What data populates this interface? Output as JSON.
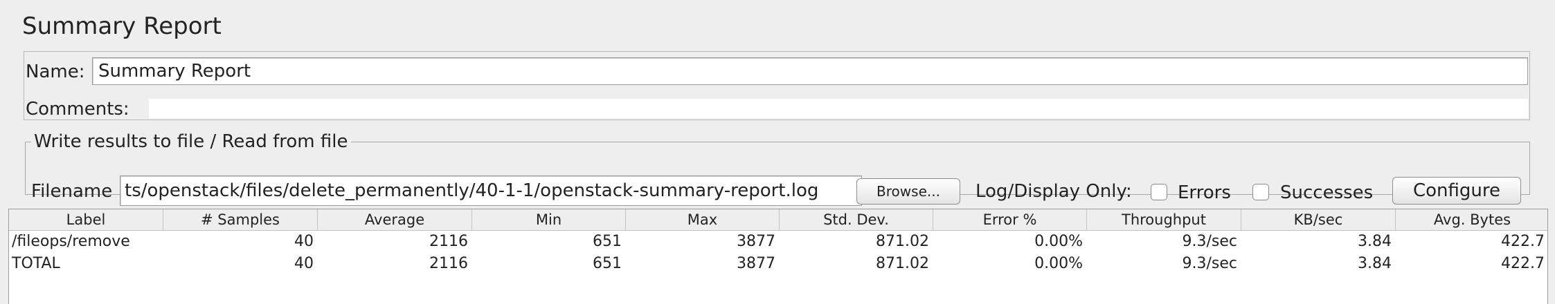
{
  "page_title": "Summary Report",
  "name_label": "Name:",
  "name_value": "Summary Report",
  "comments_label": "Comments:",
  "file_panel": {
    "legend": "Write results to file / Read from file",
    "filename_label": "Filename",
    "filename_value": "ts/openstack/files/delete_permanently/40-1-1/openstack-summary-report.log",
    "browse_label": "Browse...",
    "log_display_label": "Log/Display Only:",
    "errors_label": "Errors",
    "successes_label": "Successes",
    "configure_label": "Configure"
  },
  "table": {
    "headers": [
      "Label",
      "# Samples",
      "Average",
      "Min",
      "Max",
      "Std. Dev.",
      "Error %",
      "Throughput",
      "KB/sec",
      "Avg. Bytes"
    ],
    "rows": [
      [
        "/fileops/remove",
        "40",
        "2116",
        "651",
        "3877",
        "871.02",
        "0.00%",
        "9.3/sec",
        "3.84",
        "422.7"
      ],
      [
        "TOTAL",
        "40",
        "2116",
        "651",
        "3877",
        "871.02",
        "0.00%",
        "9.3/sec",
        "3.84",
        "422.7"
      ]
    ]
  }
}
